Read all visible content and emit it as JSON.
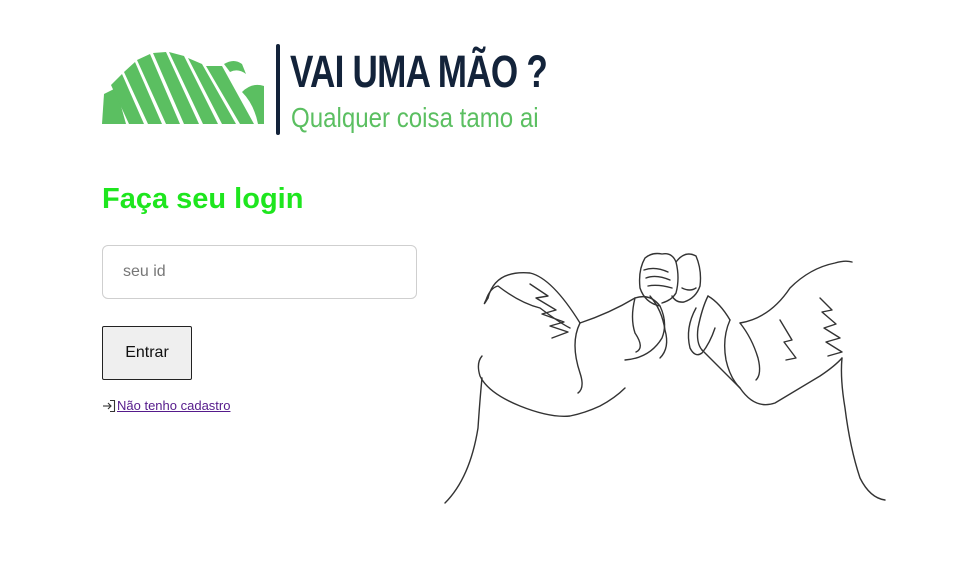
{
  "logo": {
    "title": "VAI UMA MÃO ?",
    "subtitle": "Qualquer coisa tamo ai",
    "colors": {
      "green": "#5bbf61",
      "navy": "#13233a"
    }
  },
  "login": {
    "heading": "Faça seu login",
    "heading_color": "#1ee61e",
    "id_placeholder": "seu id",
    "id_value": "",
    "submit_label": "Entrar",
    "register_icon": "login-arrow-icon",
    "register_label": "Não tenho cadastro"
  },
  "illustration": {
    "name": "fist-bump-line-art"
  }
}
